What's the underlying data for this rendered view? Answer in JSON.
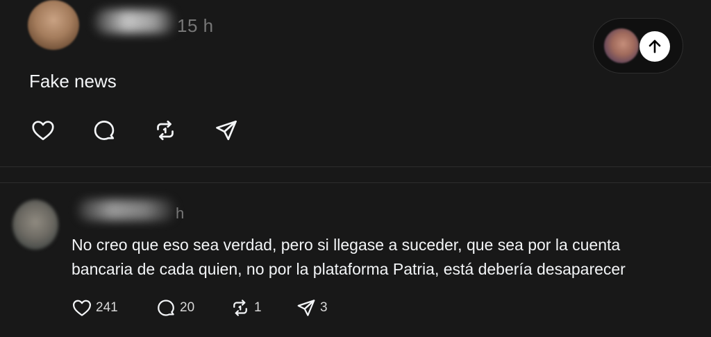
{
  "post": {
    "time": "15 h",
    "text": "Fake news",
    "actions": [
      {
        "icon": "heart-icon"
      },
      {
        "icon": "comment-icon"
      },
      {
        "icon": "repost-icon"
      },
      {
        "icon": "share-icon"
      }
    ]
  },
  "scroll_top": {
    "icon": "arrow-up-icon"
  },
  "reply": {
    "time": "h",
    "text_line1": "No creo que eso sea verdad, pero si llegase a suceder, que sea por la cuenta",
    "text_line2": "bancaria de cada quien, no por la plataforma Patria, está debería desaparecer",
    "likes": "241",
    "comments": "20",
    "reposts": "1",
    "shares": "3"
  },
  "colors": {
    "background": "#181818",
    "text": "#f3f5f7",
    "muted": "#777777",
    "divider": "#2d2d2d"
  }
}
